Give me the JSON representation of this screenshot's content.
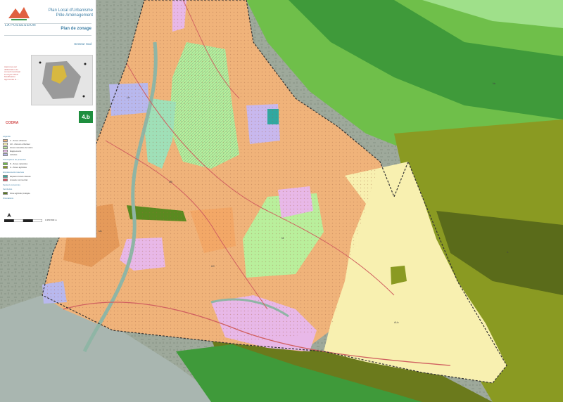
{
  "header": {
    "logo_text": "LA POSSESSION",
    "title_line1": "Plan Local d'Urbanisme",
    "title_line2": "Pôle Aménagement",
    "plan_title": "Plan de zonage",
    "sector": "Secteur Sud",
    "sheet_number": "4.b",
    "notes_lines": [
      "Approuvé par",
      "délibération du",
      "conseil municipal",
      "le 20 juin 2019",
      "Modification",
      "approuvée le ..."
    ]
  },
  "brand": {
    "consultant": "CODRA"
  },
  "legend": {
    "heading": "Légende",
    "sub_headings": [
      "Prescriptions de protection",
      "Emplacements réservés",
      "Secteurs concernés",
      "Servitudes",
      "Orientations"
    ],
    "entries": [
      {
        "color": "#f0b37a",
        "label": "U - Zones urbaines"
      },
      {
        "color": "#f8f0b0",
        "label": "AU - Zones à urbaniser"
      },
      {
        "color": "#b9ef9c",
        "label": "Zones naturelles de loisirs"
      },
      {
        "color": "#e8b8e8",
        "label": "Équipements"
      },
      {
        "color": "#b8b8ee",
        "label": "Activités"
      },
      {
        "color": "#6fbf4a",
        "label": "N - Zones naturelles"
      },
      {
        "color": "#8a9a22",
        "label": "A - Zones agricoles"
      },
      {
        "color": "#30a8a0",
        "label": "Espaces boisés classés"
      },
      {
        "color": "#e05060",
        "label": "Linéaire commercial"
      },
      {
        "color": "#5a7a20",
        "label": "Zone agricole protégée"
      }
    ]
  },
  "scale": {
    "label": "0    250   500 m"
  },
  "colors": {
    "urban": "#f0b37a",
    "urban_dark": "#e59a5a",
    "au": "#f8f0b0",
    "natural_light": "#b9ef9c",
    "natural": "#6fbf4a",
    "natural_dark": "#3f9a3a",
    "agri": "#8a9a22",
    "agri_dark": "#5a6b1a",
    "equip": "#e8b8e8",
    "activity": "#b8b8ee",
    "aerial": "#9aa89a",
    "sea": "#a9b6b0",
    "forest": "#30a8a0",
    "road": "#d06060"
  },
  "map_labels": [
    "UB",
    "UC",
    "Ua",
    "Nl",
    "Ue",
    "AUc",
    "Nc",
    "A"
  ]
}
